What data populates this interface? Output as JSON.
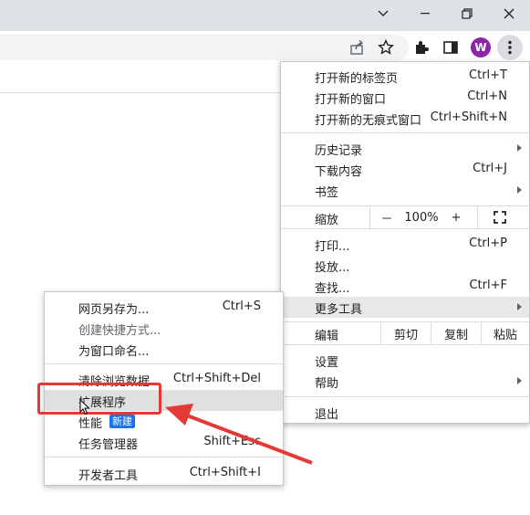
{
  "window": {
    "controls": [
      "chevron-down-icon",
      "minimize-icon",
      "restore-icon",
      "close-icon"
    ]
  },
  "toolbar": {
    "icons": [
      "share-icon",
      "bookmark-star-icon",
      "extensions-puzzle-icon",
      "side-panel-icon"
    ],
    "avatar_letter": "W",
    "avatar_color": "#8e24aa"
  },
  "menu": {
    "new_tab": {
      "label": "打开新的标签页",
      "shortcut": "Ctrl+T"
    },
    "new_window": {
      "label": "打开新的窗口",
      "shortcut": "Ctrl+N"
    },
    "incognito": {
      "label": "打开新的无痕式窗口",
      "shortcut": "Ctrl+Shift+N"
    },
    "history": {
      "label": "历史记录"
    },
    "downloads": {
      "label": "下载内容",
      "shortcut": "Ctrl+J"
    },
    "bookmarks": {
      "label": "书签"
    },
    "zoom": {
      "label": "缩放",
      "minus": "－",
      "value": "100%",
      "plus": "+"
    },
    "print": {
      "label": "打印...",
      "shortcut": "Ctrl+P"
    },
    "cast": {
      "label": "投放..."
    },
    "find": {
      "label": "查找...",
      "shortcut": "Ctrl+F"
    },
    "more_tools": {
      "label": "更多工具"
    },
    "edit": {
      "label": "编辑",
      "cut": "剪切",
      "copy": "复制",
      "paste": "粘贴"
    },
    "settings": {
      "label": "设置"
    },
    "help": {
      "label": "帮助"
    },
    "exit": {
      "label": "退出"
    }
  },
  "submenu": {
    "save_page": {
      "label": "网页另存为...",
      "shortcut": "Ctrl+S"
    },
    "create_shortcut": {
      "label": "创建快捷方式..."
    },
    "name_window": {
      "label": "为窗口命名..."
    },
    "clear_data": {
      "label": "清除浏览数据",
      "shortcut": "Ctrl+Shift+Del"
    },
    "extensions": {
      "label": "扩展程序"
    },
    "performance": {
      "label": "性能",
      "badge": "新建"
    },
    "task_manager": {
      "label": "任务管理器",
      "shortcut": "Shift+Esc"
    },
    "devtools": {
      "label": "开发者工具",
      "shortcut": "Ctrl+Shift+I"
    }
  },
  "annotation_color": "#e53935"
}
